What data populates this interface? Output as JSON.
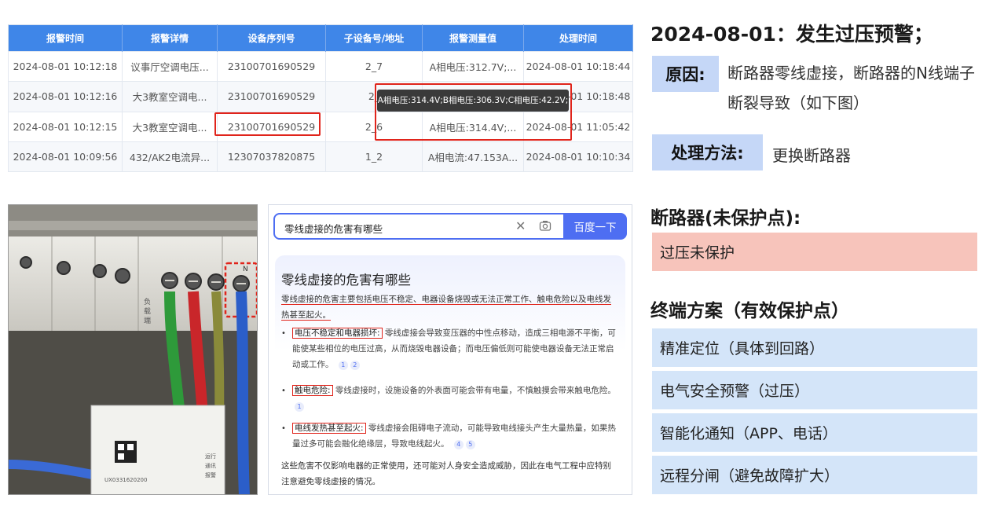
{
  "table": {
    "headers": [
      "报警时间",
      "报警详情",
      "设备序列号",
      "子设备号/地址",
      "报警测量值",
      "处理时间"
    ],
    "rows": [
      [
        "2024-08-01 10:12:18",
        "议事厅空调电压...",
        "23100701690529",
        "2_7",
        "A相电压:312.7V;...",
        "2024-08-01 10:18:44"
      ],
      [
        "2024-08-01 10:12:16",
        "大3教室空调电...",
        "23100701690529",
        "2_",
        "",
        "2024-08-01 10:18:48"
      ],
      [
        "2024-08-01 10:12:15",
        "大3教室空调电...",
        "23100701690529",
        "2_6",
        "A相电压:314.4V;...",
        "2024-08-01 11:05:42"
      ],
      [
        "2024-08-01 10:09:56",
        "432/AK2电流异...",
        "12307037820875",
        "1_2",
        "A相电流:47.153A...",
        "2024-08-01 10:10:34"
      ]
    ],
    "tooltip": "A相电压:314.4V;B相电压:306.3V;C相电压:42.2V;"
  },
  "info": {
    "event_title": "2024-08-01：发生过压预警；",
    "reason_label": "原因:",
    "reason_text": "断路器零线虚接，断路器的N线端子断裂导致（如下图）",
    "method_label": "处理方法:",
    "method_text": "更换断路器",
    "breaker_title": "断路器(未保护点):",
    "unprotected": "过压未保护",
    "terminal_title": "终端方案（有效保护点）",
    "solutions": [
      "精准定位（具体到回路）",
      "电气安全预警（过压）",
      "智能化通知（APP、电话）",
      "远程分闸（避免故障扩大）"
    ]
  },
  "photo": {
    "side_label": "负载端",
    "n_label": "N",
    "qr_code": "UX0331620200",
    "indicators": [
      "运行",
      "通讯",
      "报警"
    ]
  },
  "search": {
    "query": "零线虚接的危害有哪些",
    "button": "百度一下",
    "answer_title": "零线虚接的危害有哪些",
    "summary": "零线虚接的危害主要包括电压不稳定、电器设备烧毁或无法正常工作、触电危险以及电线发热甚至起火。",
    "items": [
      {
        "tag": "电压不稳定和电器损坏:",
        "text": "零线虚接会导致变压器的中性点移动，造成三相电源不平衡，可能使某些相位的电压过高，从而烧毁电器设备；而电压偏低则可能使电器设备无法正常启动或工作。",
        "cites": [
          "1",
          "2"
        ]
      },
      {
        "tag": "触电危险:",
        "text": "零线虚接时，设施设备的外表面可能会带有电量，不慎触摸会带来触电危险。",
        "cites": [
          "1"
        ]
      },
      {
        "tag": "电线发热甚至起火:",
        "text": "零线虚接会阻碍电子流动，可能导致电线接头产生大量热量，如果热量过多可能会融化绝缘层，导致电线起火。",
        "cites": [
          "4",
          "5"
        ]
      }
    ],
    "conclusion": "这些危害不仅影响电器的正常使用，还可能对人身安全造成威胁，因此在电气工程中应特别注意避免零线虚接的情况。"
  },
  "colors": {
    "table_header": "#3f86e8",
    "highlight_red": "#e0241b",
    "label_blue": "#c5d7f7",
    "unprotected_pink": "#f7c4bb",
    "solution_blue": "#d4e5f9",
    "search_blue": "#4e6ef2"
  }
}
